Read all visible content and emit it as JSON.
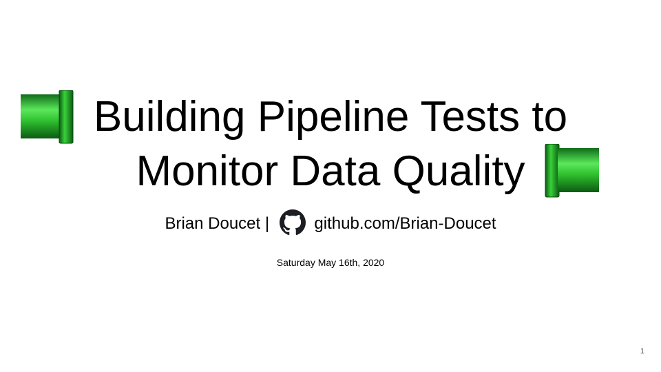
{
  "slide": {
    "title_line_1": "Building Pipeline Tests to",
    "title_line_2": "Monitor Data Quality",
    "author": "Brian Doucet |",
    "github_link": "github.com/Brian-Doucet",
    "date": "Saturday May 16th, 2020",
    "page_number": "1"
  },
  "decorations": {
    "left_pipe_icon": "green-pipe-icon",
    "right_pipe_icon": "green-pipe-icon",
    "github_icon": "github-icon"
  },
  "colors": {
    "pipe_light": "#5be85b",
    "pipe_mid": "#22b022",
    "pipe_dark": "#0b5a12",
    "text": "#000000",
    "background": "#ffffff"
  }
}
